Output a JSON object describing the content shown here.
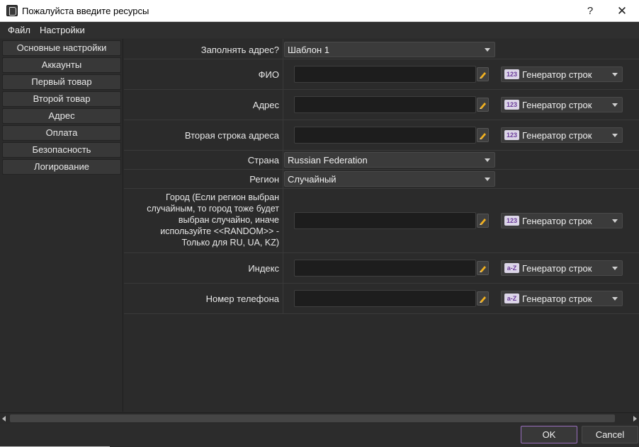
{
  "window": {
    "title": "Пожалуйста введите ресурсы",
    "help_label": "?",
    "close_label": "✕"
  },
  "menu": {
    "file": "Файл",
    "settings": "Настройки"
  },
  "sidebar": {
    "items": [
      {
        "label": "Основные настройки"
      },
      {
        "label": "Аккаунты"
      },
      {
        "label": "Первый товар"
      },
      {
        "label": "Второй товар"
      },
      {
        "label": "Адрес"
      },
      {
        "label": "Оплата"
      },
      {
        "label": "Безопасность"
      },
      {
        "label": "Логирование"
      }
    ]
  },
  "form": {
    "fill_address": {
      "label": "Заполнять адрес?",
      "value": "Шаблон 1"
    },
    "fio": {
      "label": "ФИО",
      "value": "",
      "generator_badge": "123",
      "generator": "Генератор строк"
    },
    "address": {
      "label": "Адрес",
      "value": "",
      "generator_badge": "123",
      "generator": "Генератор строк"
    },
    "address2": {
      "label": "Вторая строка адреса",
      "value": "",
      "generator_badge": "123",
      "generator": "Генератор строк"
    },
    "country": {
      "label": "Страна",
      "value": "Russian Federation"
    },
    "region": {
      "label": "Регион",
      "value": "Случайный"
    },
    "city": {
      "label_lines": [
        "Город (Если регион выбран",
        "случайным, то город тоже будет",
        "выбран случайно, иначе",
        "используйте <<RANDOM>> -",
        "Только для RU, UA, KZ)"
      ],
      "value": "",
      "generator_badge": "123",
      "generator": "Генератор строк"
    },
    "index": {
      "label": "Индекс",
      "value": "",
      "generator_badge": "a-Z",
      "generator": "Генератор строк"
    },
    "phone": {
      "label": "Номер телефона",
      "value": "",
      "generator_badge": "a-Z",
      "generator": "Генератор строк"
    }
  },
  "footer": {
    "ok": "OK",
    "cancel": "Cancel"
  },
  "colors": {
    "ok_border": "#9a6fbf",
    "badge_bg": "#dcd6e8",
    "badge_text": "#6a3a9a"
  },
  "icons": {
    "edit": "pencil-icon",
    "app": "app-icon"
  }
}
